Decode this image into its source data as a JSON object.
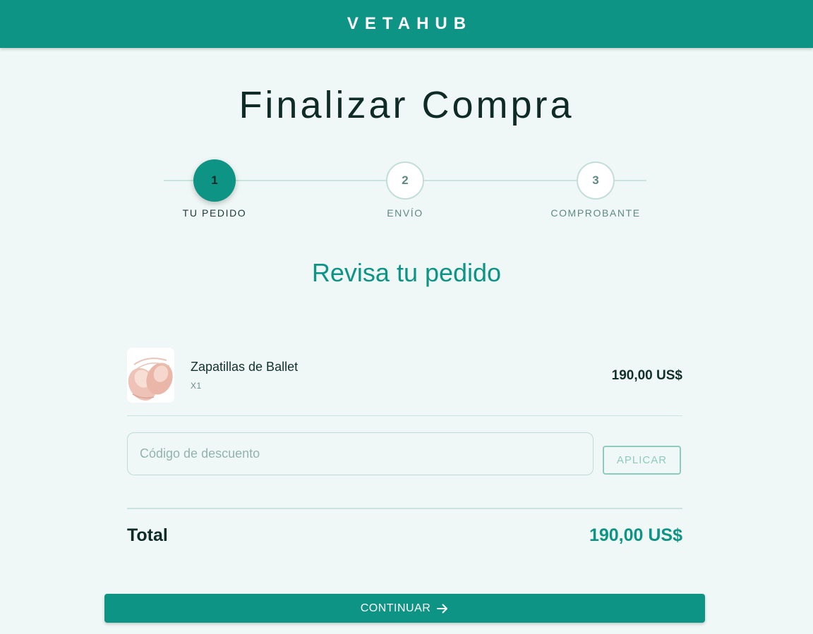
{
  "header": {
    "brand": "VETAHUB"
  },
  "page": {
    "title": "Finalizar Compra"
  },
  "stepper": {
    "steps": [
      {
        "number": "1",
        "label": "TU PEDIDO",
        "state": "active"
      },
      {
        "number": "2",
        "label": "ENVÍO",
        "state": "pending"
      },
      {
        "number": "3",
        "label": "COMPROBANTE",
        "state": "pending"
      }
    ]
  },
  "review": {
    "title": "Revisa tu pedido",
    "items": [
      {
        "name": "Zapatillas de Ballet",
        "quantity": "X1",
        "price": "190,00 US$",
        "thumbnail_icon": "ballet-shoes-image"
      }
    ]
  },
  "discount": {
    "placeholder": "Código de descuento",
    "value": "",
    "apply_label": "APLICAR"
  },
  "totals": {
    "label": "Total",
    "value": "190,00 US$"
  },
  "actions": {
    "continue_label": "CONTINUAR",
    "continue_icon": "arrow-right-icon"
  },
  "colors": {
    "primary": "#0e9484",
    "background": "#eff8f6",
    "text": "#0f2b26",
    "muted": "#5e8a82",
    "outline": "#8fcabe"
  }
}
